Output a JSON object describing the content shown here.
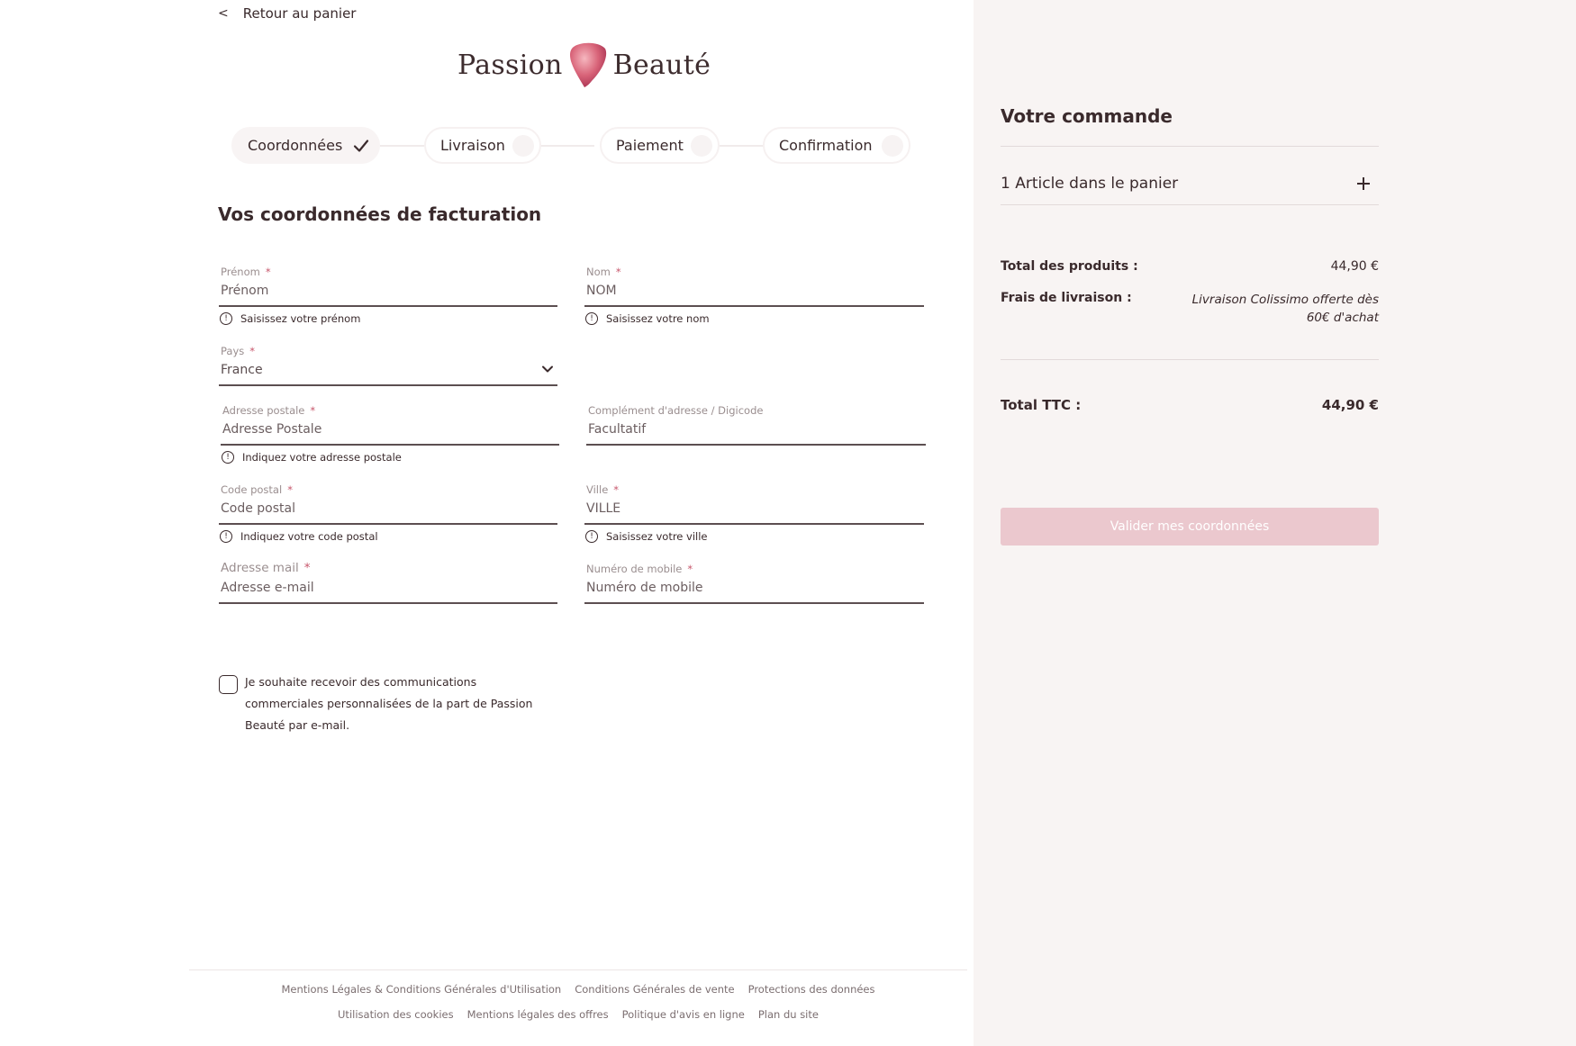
{
  "nav": {
    "back_label": "Retour au panier",
    "back_chevron": "<"
  },
  "logo": {
    "word1": "Passion",
    "word2": "Beauté"
  },
  "stepper": {
    "steps": [
      {
        "label": "Coordonnées"
      },
      {
        "label": "Livraison"
      },
      {
        "label": "Paiement"
      },
      {
        "label": "Confirmation"
      }
    ]
  },
  "form": {
    "title": "Vos coordonnées de facturation",
    "required_mark": "*",
    "prenom": {
      "label": "Prénom",
      "placeholder": "Prénom",
      "hint": "Saisissez votre prénom"
    },
    "nom": {
      "label": "Nom",
      "placeholder": "NOM",
      "hint": "Saisissez votre nom"
    },
    "pays": {
      "label": "Pays",
      "value": "France"
    },
    "adresse": {
      "label": "Adresse postale",
      "placeholder": "Adresse Postale",
      "hint": "Indiquez votre adresse postale"
    },
    "complement": {
      "label": "Complément d'adresse / Digicode",
      "placeholder": "Facultatif"
    },
    "code_postal": {
      "label": "Code postal",
      "placeholder": "Code postal",
      "hint": "Indiquez votre code postal"
    },
    "ville": {
      "label": "Ville",
      "placeholder": "VILLE",
      "hint": "Saisissez votre ville"
    },
    "email": {
      "label": "Adresse mail",
      "placeholder": "Adresse e-mail"
    },
    "mobile": {
      "label": "Numéro de mobile",
      "placeholder": "Numéro de mobile"
    },
    "optin": {
      "text": "Je souhaite recevoir des communications commerciales personnalisées de la part de Passion Beauté par e-mail."
    }
  },
  "footer": {
    "row1": [
      "Mentions Légales & Conditions Générales d'Utilisation",
      "Conditions Générales de vente",
      "Protections des données"
    ],
    "row2": [
      "Utilisation des cookies",
      "Mentions légales des offres",
      "Politique d'avis en ligne",
      "Plan du site"
    ]
  },
  "order": {
    "title": "Votre commande",
    "cart_summary": "1 Article dans le panier",
    "total_products_label": "Total des produits :",
    "total_products_value": "44,90 €",
    "shipping_label": "Frais de livraison :",
    "shipping_value": "Livraison Colissimo offerte dès 60€ d'achat",
    "total_ttc_label": "Total TTC :",
    "total_ttc_value": "44,90 €",
    "submit_label": "Valider mes coordonnées"
  },
  "colors": {
    "accent": "#ebc8ce",
    "required": "#c7566b",
    "sidebar_bg": "#f8f4f3",
    "text": "#3a2a2c"
  }
}
